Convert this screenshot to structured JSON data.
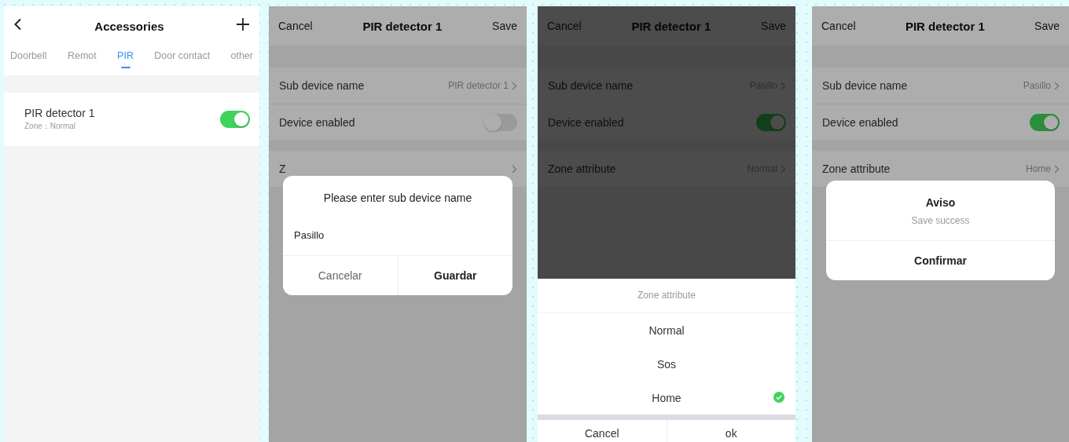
{
  "screens": [
    {
      "kind": "accessories",
      "title": "Accessories",
      "tabs": [
        {
          "label": "Doorbell",
          "selected": false
        },
        {
          "label": "Remot",
          "selected": false
        },
        {
          "label": "PIR",
          "selected": true
        },
        {
          "label": "Door contact",
          "selected": false
        },
        {
          "label": "other",
          "selected": false
        }
      ],
      "devices": [
        {
          "name": "PIR detector 1",
          "zone": "Zone：Normal",
          "on": true
        }
      ]
    },
    {
      "kind": "settings",
      "cancel": "Cancel",
      "title": "PIR detector 1",
      "save": "Save",
      "rows": [
        {
          "kind": "value",
          "label": "Sub device name",
          "value": "PIR detector 1"
        },
        {
          "kind": "toggle",
          "label": "Device enabled",
          "on": false
        },
        {
          "kind": "value",
          "label": "Z"
        }
      ],
      "popup": {
        "kind": "prompt",
        "title": "Please enter sub device name",
        "value": "Pasillo",
        "buttons": [
          {
            "label": "Cancelar",
            "primary": false
          },
          {
            "label": "Guardar",
            "primary": true
          }
        ]
      }
    },
    {
      "kind": "settings",
      "cancel": "Cancel",
      "title": "PIR detector 1",
      "save": "Save",
      "rows": [
        {
          "kind": "value",
          "label": "Sub device name",
          "value": "Pasillo"
        },
        {
          "kind": "toggle",
          "label": "Device enabled",
          "on": true
        },
        {
          "kind": "value",
          "label": "Zone attribute",
          "value": "Normal"
        }
      ],
      "popup": {
        "kind": "sheet",
        "title": "Zone attribute",
        "options": [
          {
            "label": "Normal",
            "selected": false
          },
          {
            "label": "Sos",
            "selected": false
          },
          {
            "label": "Home",
            "selected": true
          }
        ],
        "buttons": [
          {
            "label": "Cancel",
            "primary": false
          },
          {
            "label": "ok",
            "primary": false
          }
        ]
      }
    },
    {
      "kind": "settings",
      "cancel": "Cancel",
      "title": "PIR detector 1",
      "save": "Save",
      "rows": [
        {
          "kind": "value",
          "label": "Sub device name",
          "value": "Pasillo"
        },
        {
          "kind": "toggle",
          "label": "Device enabled",
          "on": true
        },
        {
          "kind": "value",
          "label": "Zone attribute",
          "value": "Home"
        }
      ],
      "popup": {
        "kind": "alert",
        "title": "Aviso",
        "message": "Save success",
        "buttons": [
          {
            "label": "Confirmar",
            "primary": true
          }
        ]
      }
    }
  ]
}
